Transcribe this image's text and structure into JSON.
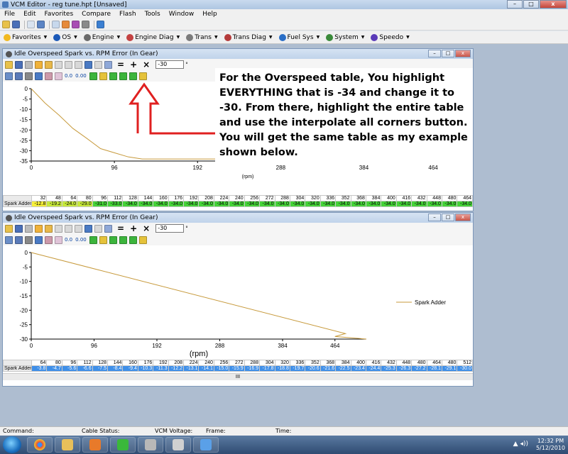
{
  "window": {
    "title": "VCM Editor - reg tune.hpt   [Unsaved]",
    "minimize": "–",
    "maximize": "□",
    "close": "x"
  },
  "menu": [
    "File",
    "Edit",
    "Favorites",
    "Compare",
    "Flash",
    "Tools",
    "Window",
    "Help"
  ],
  "nav_toolbar": [
    "Favorites",
    "OS",
    "Engine",
    "Engine Diag",
    "Trans",
    "Trans Diag",
    "Fuel Sys",
    "System",
    "Speedo"
  ],
  "table1": {
    "title": "Idle Overspeed Spark vs. RPM Error (In Gear)",
    "value_input": "-30",
    "unit_symbol": "°",
    "toolbar_text_a": "0.0",
    "toolbar_text_b": "0.00",
    "ops": [
      "=",
      "+",
      "×"
    ],
    "xlabel": "(rpm)",
    "x_ticks": [
      "0",
      "96",
      "192",
      "288",
      "384",
      "464"
    ],
    "y_ticks": [
      "0",
      "-5",
      "-10",
      "-15",
      "-20",
      "-25",
      "-30",
      "-35"
    ],
    "columns": [
      "32",
      "48",
      "64",
      "80",
      "96",
      "112",
      "128",
      "144",
      "160",
      "176",
      "192",
      "208",
      "224",
      "240",
      "256",
      "272",
      "288",
      "304",
      "320",
      "336",
      "352",
      "368",
      "384",
      "400",
      "416",
      "432",
      "448",
      "480",
      "464"
    ],
    "row_label": "Spark Adder",
    "values": [
      "-12.8",
      "-19.2",
      "-24.0",
      "-29.0",
      "-31.0",
      "-33.0",
      "-34.0",
      "-34.0",
      "-34.0",
      "-34.0",
      "-34.0",
      "-34.0",
      "-34.0",
      "-34.0",
      "-34.0",
      "-34.0",
      "-34.0",
      "-34.0",
      "-34.0",
      "-34.0",
      "-34.0",
      "-34.0",
      "-34.0",
      "-34.0",
      "-34.0",
      "-34.0",
      "-34.0",
      "-34.0",
      "-34.0"
    ]
  },
  "table2": {
    "title": "Idle Overspeed Spark vs. RPM Error (In Gear)",
    "value_input": "-30",
    "unit_symbol": "°",
    "toolbar_text_a": "0.0",
    "toolbar_text_b": "0.00",
    "ops": [
      "=",
      "+",
      "×"
    ],
    "xlabel": "(rpm)",
    "x_ticks": [
      "0",
      "96",
      "192",
      "288",
      "384",
      "464"
    ],
    "y_ticks": [
      "0",
      "-5",
      "-10",
      "-15",
      "-20",
      "-25",
      "-30"
    ],
    "legend": "Spark Adder",
    "columns": [
      "64",
      "80",
      "96",
      "112",
      "128",
      "144",
      "160",
      "176",
      "192",
      "208",
      "224",
      "240",
      "256",
      "272",
      "288",
      "304",
      "320",
      "336",
      "352",
      "368",
      "384",
      "400",
      "416",
      "432",
      "448",
      "480",
      "464",
      "480",
      "512"
    ],
    "row_label": "Spark Adder",
    "values": [
      "-3.8",
      "-4.7",
      "-5.6",
      "-6.6",
      "-7.5",
      "-8.4",
      "-9.4",
      "-10.3",
      "-11.3",
      "-12.2",
      "-13.1",
      "-14.1",
      "-15.0",
      "-15.9",
      "-16.9",
      "-17.8",
      "-18.8",
      "-19.7",
      "-20.6",
      "-21.6",
      "-22.5",
      "-23.4",
      "-24.4",
      "-25.3",
      "-26.3",
      "-27.2",
      "-28.1",
      "-29.1",
      "-30.0"
    ],
    "scroll_mark": "III"
  },
  "callout": {
    "text": "For the Overspeed table, You highlight EVERYTHING that is -34 and change it to -30. From there, highlight the entire table and use the interpolate all corners button. You will get the same table as my example shown below."
  },
  "status": {
    "command": "Command:",
    "cable": "Cable Status:",
    "vcm_voltage": "VCM Voltage:",
    "frame": "Frame:",
    "time": "Time:"
  },
  "clock": {
    "time": "12:32 PM",
    "date": "5/12/2010"
  },
  "chart_data": [
    {
      "type": "line",
      "title": "Idle Overspeed Spark vs. RPM Error (In Gear)",
      "xlabel": "(rpm)",
      "ylabel": "",
      "x": [
        0,
        16,
        32,
        48,
        64,
        80,
        96,
        112,
        128,
        144,
        480
      ],
      "values": [
        0,
        -7,
        -12.8,
        -19.2,
        -24.0,
        -29.0,
        -31.0,
        -33.0,
        -34.0,
        -34.0,
        -34.0
      ],
      "xlim": [
        0,
        500
      ],
      "ylim": [
        -35,
        0
      ],
      "grid": false
    },
    {
      "type": "line",
      "title": "Idle Overspeed Spark vs. RPM Error (In Gear)",
      "xlabel": "(rpm)",
      "ylabel": "",
      "series": [
        {
          "name": "Spark Adder",
          "x": [
            0,
            480,
            464,
            512
          ],
          "values": [
            0,
            -28.1,
            -29.1,
            -30.0
          ]
        }
      ],
      "xlim": [
        0,
        512
      ],
      "ylim": [
        -30,
        0
      ],
      "legend": "right",
      "grid": false
    }
  ]
}
